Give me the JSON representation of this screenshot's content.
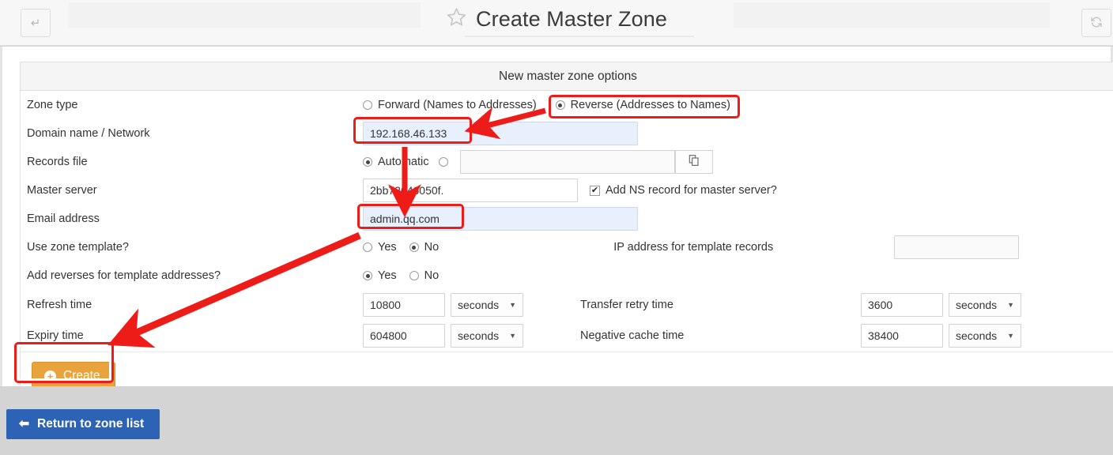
{
  "window": {
    "title": "Create Master Zone",
    "back_icon": "return-arrow-icon",
    "refresh_icon": "refresh-icon",
    "star_icon": "star-favorite-icon"
  },
  "panel": {
    "header": "New master zone options"
  },
  "form": {
    "zone_type": {
      "label": "Zone type",
      "options": [
        {
          "label": "Forward (Names to Addresses)",
          "selected": false
        },
        {
          "label": "Reverse (Addresses to Names)",
          "selected": true
        }
      ]
    },
    "domain_name": {
      "label": "Domain name / Network",
      "value": "192.168.46.133"
    },
    "records_file": {
      "label": "Records file",
      "automatic_label": "Automatic",
      "automatic_selected": true,
      "manual_selected": false,
      "path_value": "",
      "browse_icon": "file-chooser-icon"
    },
    "master_server": {
      "label": "Master server",
      "value": "2bb72646050f.",
      "checkbox_label": "Add NS record for master server?",
      "checkbox_checked": true,
      "checkbox_glyph": "✔"
    },
    "email_address": {
      "label": "Email address",
      "value": "admin.qq.com"
    },
    "use_zone_template": {
      "label": "Use zone template?",
      "yes_label": "Yes",
      "no_label": "No",
      "selected": "No"
    },
    "ip_for_template": {
      "label": "IP address for template records",
      "value": ""
    },
    "add_reverses": {
      "label": "Add reverses for template addresses?",
      "yes_label": "Yes",
      "no_label": "No",
      "selected": "Yes"
    },
    "refresh_time": {
      "label": "Refresh time",
      "value": "10800",
      "unit": "seconds"
    },
    "transfer_retry_time": {
      "label": "Transfer retry time",
      "value": "3600",
      "unit": "seconds"
    },
    "expiry_time": {
      "label": "Expiry time",
      "value": "604800",
      "unit": "seconds"
    },
    "negative_cache_time": {
      "label": "Negative cache time",
      "value": "38400",
      "unit": "seconds"
    }
  },
  "actions": {
    "create_label": "Create",
    "create_icon": "plus-circle-icon",
    "return_label": "Return to zone list",
    "return_icon": "arrow-left-icon"
  },
  "colors": {
    "accent_orange": "#e8a33d",
    "accent_blue": "#2c63b4",
    "annotation_red": "#ee1c19",
    "autofill_blue": "#e8f0fe",
    "page_background": "#d4d4d4"
  }
}
